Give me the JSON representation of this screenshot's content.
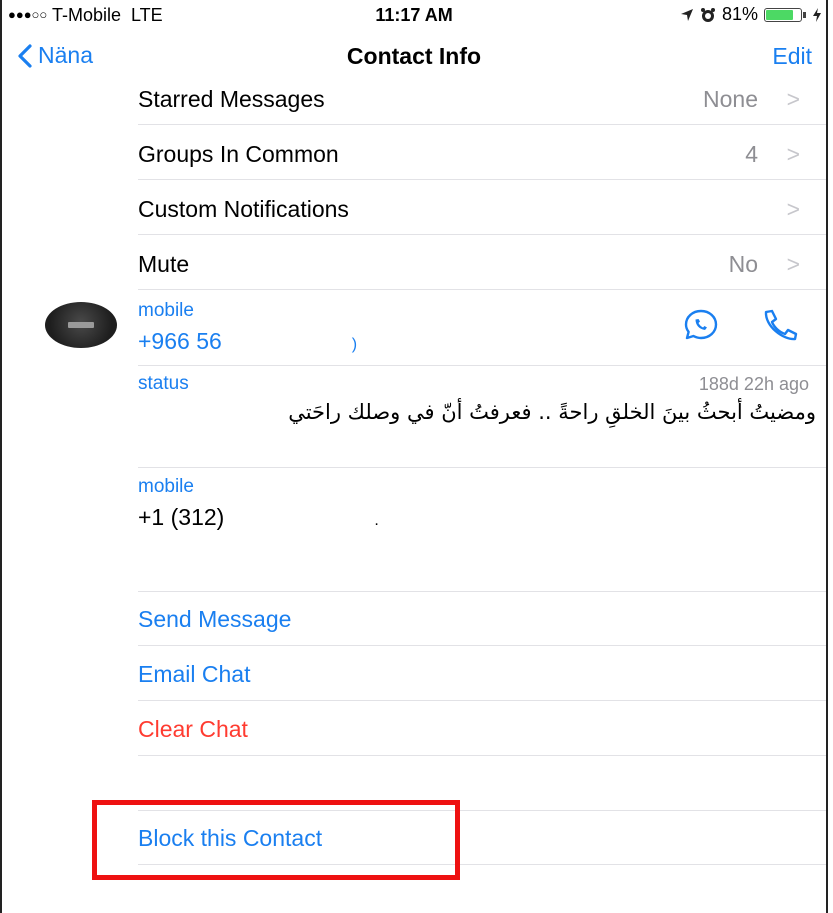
{
  "status_bar": {
    "signal_dots": "●●●○○",
    "carrier": "T-Mobile",
    "network": "LTE",
    "time": "11:17 AM",
    "battery_percent": "81%",
    "battery_level": 0.81,
    "icons": [
      "location-arrow-icon",
      "alarm-clock-icon",
      "battery-icon",
      "charging-bolt-icon"
    ]
  },
  "nav": {
    "back_label": "Näna",
    "title": "Contact Info",
    "edit_label": "Edit"
  },
  "info_rows": [
    {
      "label": "Starred Messages",
      "value": "None",
      "chevron": ">"
    },
    {
      "label": "Groups In Common",
      "value": "4",
      "chevron": ">"
    },
    {
      "label": "Custom Notifications",
      "value": "",
      "chevron": ">"
    },
    {
      "label": "Mute",
      "value": "No",
      "chevron": ">"
    }
  ],
  "phones": [
    {
      "label": "mobile",
      "number": "+966 56",
      "number_tail": ")"
    },
    {
      "label": "mobile",
      "number": "+1 (312)",
      "number_tail": "."
    }
  ],
  "status": {
    "label": "status",
    "time_ago": "188d 22h ago",
    "text": "ومضيتُ أبحثُ بينَ الخلقِ راحةً .. فعرفتُ أنّ في وصلك راحَتي"
  },
  "actions": {
    "send_message": "Send Message",
    "email_chat": "Email Chat",
    "clear_chat": "Clear Chat",
    "block_contact": "Block this Contact"
  },
  "colors": {
    "accent": "#1a7ff0",
    "destructive": "#ff3b30",
    "secondary_text": "#8e8e93",
    "highlight": "#ee1111"
  }
}
